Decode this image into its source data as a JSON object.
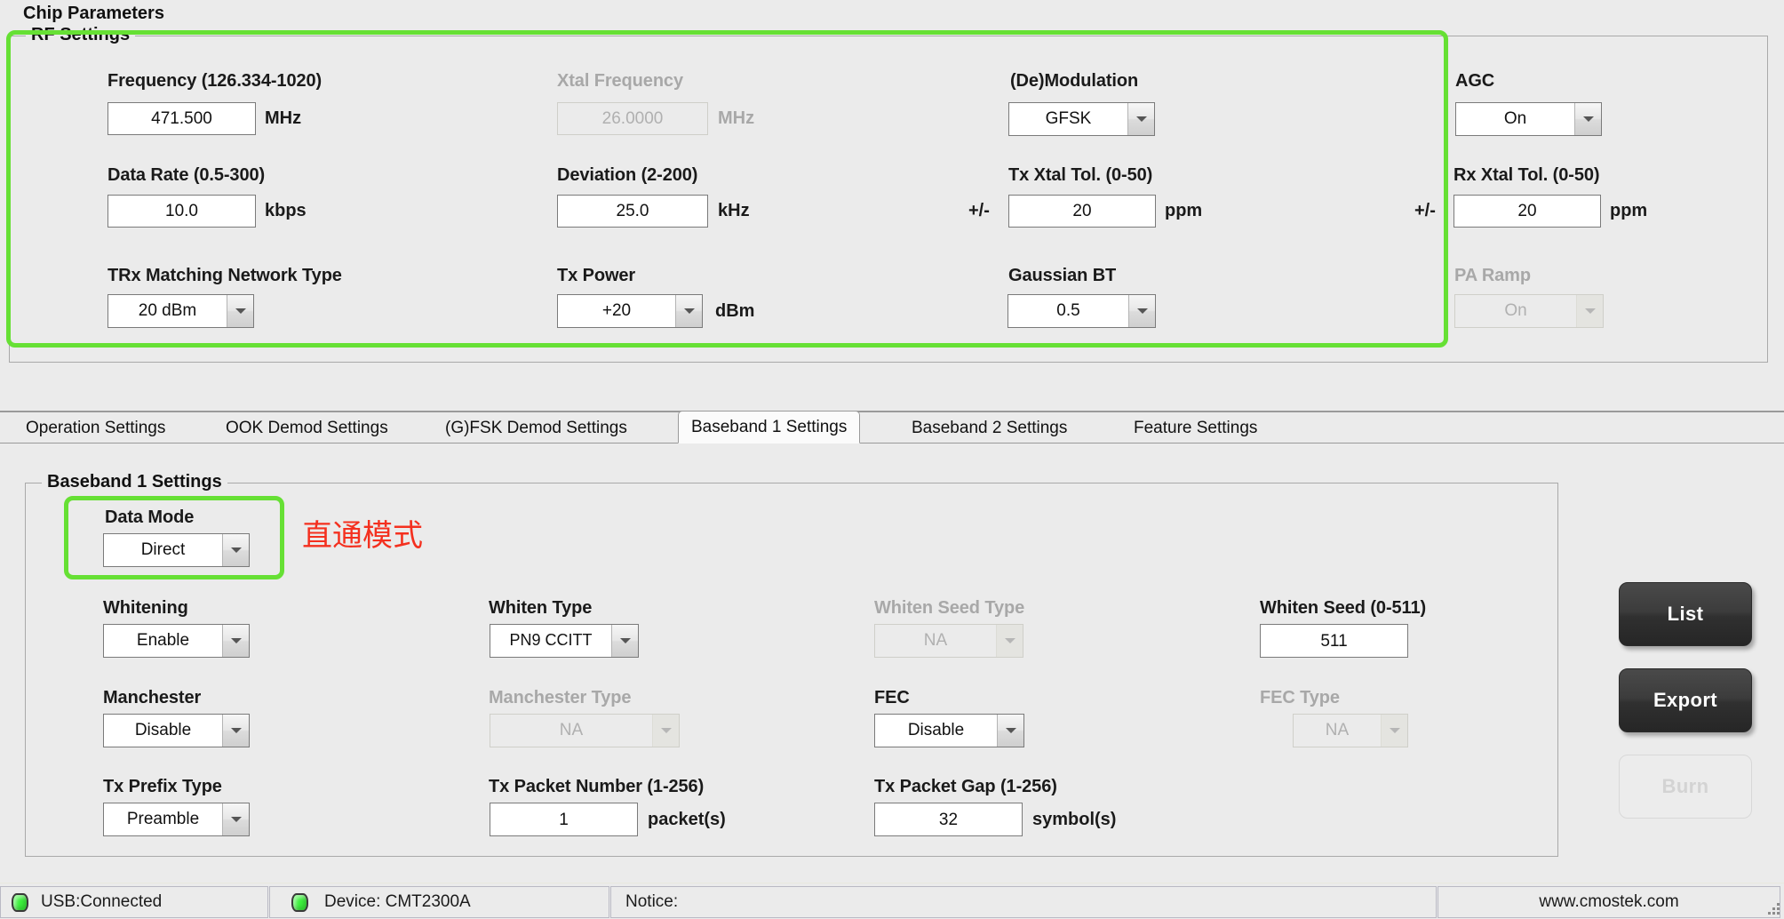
{
  "page": {
    "title": "Chip Parameters"
  },
  "rf": {
    "group_title": "RF Settings",
    "fields": [
      {
        "label": "Frequency (126.334-1020)",
        "value": "471.500",
        "unit": "MHz",
        "kind": "text",
        "disabled": false
      },
      {
        "label": "Xtal Frequency",
        "value": "26.0000",
        "unit": "MHz",
        "kind": "text",
        "disabled": true
      },
      {
        "label": "(De)Modulation",
        "value": "GFSK",
        "unit": "",
        "kind": "combo",
        "disabled": false
      },
      {
        "label": "AGC",
        "value": "On",
        "unit": "",
        "kind": "combo",
        "disabled": false
      },
      {
        "label": "Data Rate (0.5-300)",
        "value": "10.0",
        "unit": "kbps",
        "kind": "text",
        "disabled": false
      },
      {
        "label": "Deviation (2-200)",
        "value": "25.0",
        "unit": "kHz",
        "kind": "text",
        "disabled": false
      },
      {
        "label": "Tx Xtal Tol. (0-50)",
        "prefix": "+/-",
        "value": "20",
        "unit": "ppm",
        "kind": "text",
        "disabled": false
      },
      {
        "label": "Rx Xtal Tol. (0-50)",
        "prefix": "+/-",
        "value": "20",
        "unit": "ppm",
        "kind": "text",
        "disabled": false
      },
      {
        "label": "TRx Matching Network Type",
        "value": "20 dBm",
        "unit": "",
        "kind": "combo",
        "disabled": false
      },
      {
        "label": "Tx Power",
        "value": "+20",
        "unit": "dBm",
        "kind": "combo",
        "disabled": false
      },
      {
        "label": "Gaussian BT",
        "value": "0.5",
        "unit": "",
        "kind": "combo",
        "disabled": false
      },
      {
        "label": "PA Ramp",
        "value": "On",
        "unit": "",
        "kind": "combo",
        "disabled": true
      }
    ]
  },
  "tabs": [
    {
      "label": "Operation Settings",
      "active": false
    },
    {
      "label": "OOK Demod Settings",
      "active": false
    },
    {
      "label": "(G)FSK Demod Settings",
      "active": false
    },
    {
      "label": "Baseband 1 Settings",
      "active": true
    },
    {
      "label": "Baseband 2 Settings",
      "active": false
    },
    {
      "label": "Feature Settings",
      "active": false
    }
  ],
  "baseband1": {
    "group_title": "Baseband 1 Settings",
    "annotation": "直通模式",
    "fields": [
      {
        "label": "Data Mode",
        "value": "Direct",
        "unit": "",
        "kind": "combo",
        "disabled": false
      },
      {
        "label": "Whitening",
        "value": "Enable",
        "unit": "",
        "kind": "combo",
        "disabled": false
      },
      {
        "label": "Whiten Type",
        "value": "PN9 CCITT",
        "unit": "",
        "kind": "combo",
        "disabled": false
      },
      {
        "label": "Whiten Seed Type",
        "value": "NA",
        "unit": "",
        "kind": "combo",
        "disabled": true
      },
      {
        "label": "Whiten Seed (0-511)",
        "value": "511",
        "unit": "",
        "kind": "text",
        "disabled": false
      },
      {
        "label": "Manchester",
        "value": "Disable",
        "unit": "",
        "kind": "combo",
        "disabled": false
      },
      {
        "label": "Manchester Type",
        "value": "NA",
        "unit": "",
        "kind": "combo",
        "disabled": true
      },
      {
        "label": "FEC",
        "value": "Disable",
        "unit": "",
        "kind": "combo",
        "disabled": false
      },
      {
        "label": "FEC Type",
        "value": "NA",
        "unit": "",
        "kind": "combo",
        "disabled": true
      },
      {
        "label": "Tx Prefix Type",
        "value": "Preamble",
        "unit": "",
        "kind": "combo",
        "disabled": false
      },
      {
        "label": "Tx Packet Number (1-256)",
        "value": "1",
        "unit": "packet(s)",
        "kind": "text",
        "disabled": false
      },
      {
        "label": "Tx Packet Gap (1-256)",
        "value": "32",
        "unit": "symbol(s)",
        "kind": "text",
        "disabled": false
      }
    ]
  },
  "actions": [
    {
      "label": "List",
      "enabled": true
    },
    {
      "label": "Export",
      "enabled": true
    },
    {
      "label": "Burn",
      "enabled": false
    }
  ],
  "status": {
    "usb": "USB:Connected",
    "device": "Device: CMT2300A",
    "notice": "Notice:",
    "website": "www.cmostek.com"
  },
  "colors": {
    "highlight": "#66e034",
    "annotation": "#f4301f",
    "led": "#3cf03c",
    "panel": "#ebebeb"
  }
}
